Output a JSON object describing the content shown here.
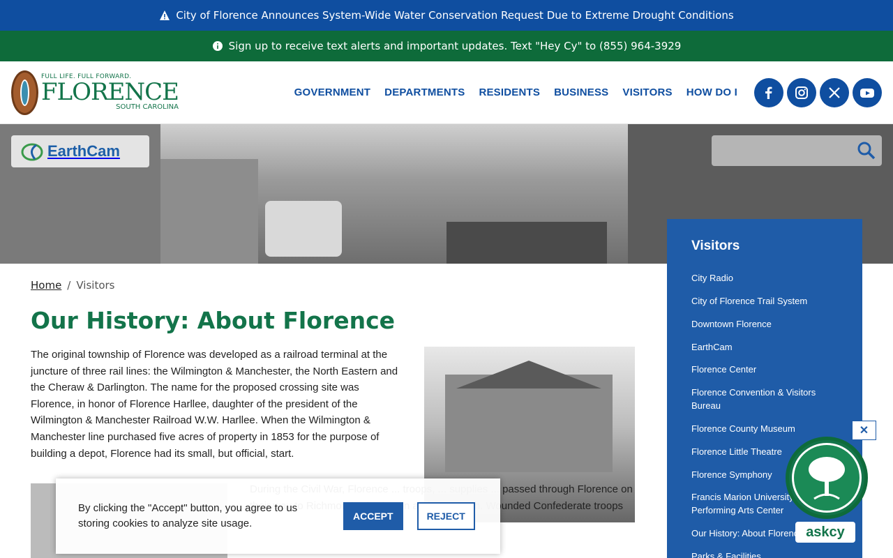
{
  "alerts": {
    "water": "City of Florence Announces System-Wide Water Conservation Request Due to Extreme Drought Conditions",
    "text_alerts": "Sign up to receive text alerts and important updates. Text \"Hey Cy\" to (855) 964-3929"
  },
  "logo": {
    "tagline": "FULL LIFE. FULL FORWARD.",
    "name": "FLORENCE",
    "state": "SOUTH CAROLINA"
  },
  "nav": [
    "GOVERNMENT",
    "DEPARTMENTS",
    "RESIDENTS",
    "BUSINESS",
    "VISITORS",
    "HOW DO I"
  ],
  "social": [
    "facebook-icon",
    "instagram-icon",
    "x-icon",
    "youtube-icon"
  ],
  "hero": {
    "earthcam": "EarthCam",
    "search_placeholder": ""
  },
  "breadcrumb": {
    "home": "Home",
    "separator": "/",
    "current": "Visitors"
  },
  "page": {
    "title": "Our History: About Florence",
    "intro": "The original township of Florence was developed as a railroad terminal at the juncture of three rail lines: the Wilmington & Manchester, the North Eastern and the Cheraw & Darlington. The name for the proposed crossing site was Florence, in honor of Florence Harllee, daughter of the president of the Wilmington & Manchester Railroad W.W. Harllee. When the Wilmington & Manchester line purchased five acres of property in 1853 for the purpose of building a depot, Florence had its small, but official, start.",
    "lower": "During the Civil War, Florence ... troops, ... supplies ... passed through Florence on their way to Richmond, Charleston and Savannah. Wounded Confederate troops"
  },
  "sidebar": {
    "title": "Visitors",
    "items": [
      "City Radio",
      "City of Florence Trail System",
      "Downtown Florence",
      "EarthCam",
      "Florence Center",
      "Florence Convention & Visitors Bureau",
      "Florence County Museum",
      "Florence Little Theatre",
      "Florence Symphony",
      "Francis Marion University Performing Arts Center",
      "Our History: About Florence",
      "Parks & Facilities"
    ]
  },
  "cookie": {
    "message": "By clicking the \"Accept\" button, you agree to us storing cookies to analyze site usage.",
    "accept": "ACCEPT",
    "reject": "REJECT"
  },
  "askcy": {
    "label": "askcy",
    "close": "✕"
  },
  "colors": {
    "blue": "#0f4ea0",
    "green": "#0e6b3a",
    "title_green": "#13744a",
    "sidebar_blue": "#1f5ca8"
  }
}
